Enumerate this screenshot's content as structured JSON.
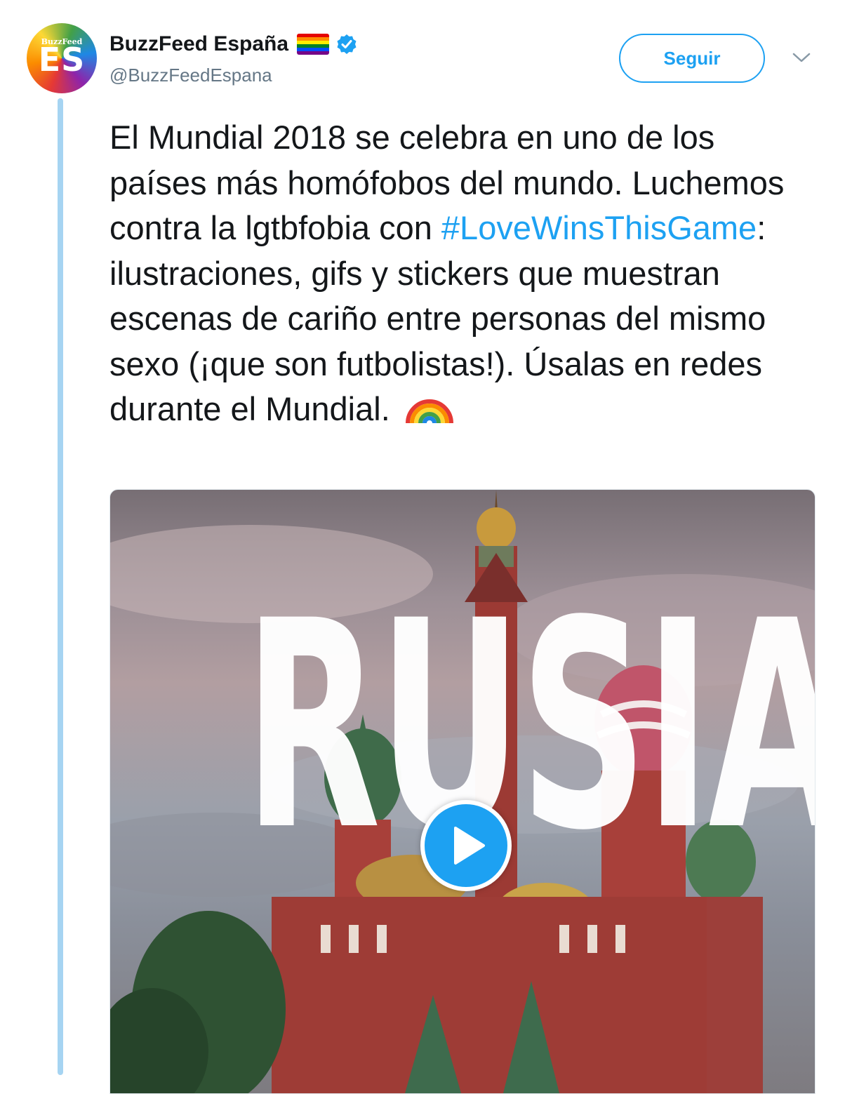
{
  "tweet": {
    "author": {
      "name": "BuzzFeed España",
      "handle": "@BuzzFeedEspana",
      "avatar_small_text": "BuzzFeed",
      "avatar_big_text": "ES",
      "verified": true,
      "name_emoji": "rainbow-flag-icon"
    },
    "follow_label": "Seguir",
    "menu_icon": "chevron-down-icon",
    "text": {
      "part1": "El Mundial 2018 se celebra en uno de los países más homófobos del mundo. Luchemos contra la lgtbfobia con ",
      "hashtag": "#LoveWinsThisGame",
      "part2": ": ilustraciones, gifs y stickers que muestran escenas de cariño entre personas del mismo sexo (¡que son futbolistas!). Úsalas en redes durante el Mundial. ",
      "emoji": "rainbow-icon"
    },
    "media": {
      "overlay_text": "RUSIA",
      "play_icon": "play-icon"
    }
  },
  "colors": {
    "accent": "#1da1f2",
    "text": "#14171a",
    "secondary": "#657786",
    "thread_line": "#a6d4f2"
  }
}
